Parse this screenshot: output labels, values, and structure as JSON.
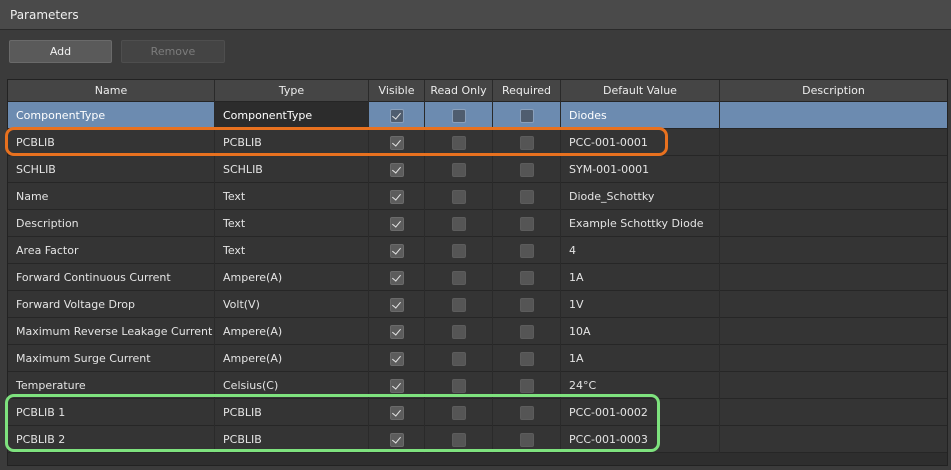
{
  "panel": {
    "title": "Parameters"
  },
  "toolbar": {
    "add_label": "Add",
    "remove_label": "Remove"
  },
  "columns": [
    "Name",
    "Type",
    "Visible",
    "Read Only",
    "Required",
    "Default Value",
    "Description"
  ],
  "rows": [
    {
      "name": "ComponentType",
      "type": "ComponentType",
      "visible": true,
      "read_only": false,
      "required": false,
      "default": "Diodes",
      "description": "",
      "selected": true
    },
    {
      "name": "PCBLIB",
      "type": "PCBLIB",
      "visible": true,
      "read_only": false,
      "required": false,
      "default": "PCC-001-0001",
      "description": ""
    },
    {
      "name": "SCHLIB",
      "type": "SCHLIB",
      "visible": true,
      "read_only": false,
      "required": false,
      "default": "SYM-001-0001",
      "description": ""
    },
    {
      "name": "Name",
      "type": "Text",
      "visible": true,
      "read_only": false,
      "required": false,
      "default": "Diode_Schottky",
      "description": ""
    },
    {
      "name": "Description",
      "type": "Text",
      "visible": true,
      "read_only": false,
      "required": false,
      "default": "Example Schottky Diode",
      "description": ""
    },
    {
      "name": "Area Factor",
      "type": "Text",
      "visible": true,
      "read_only": false,
      "required": false,
      "default": "4",
      "description": ""
    },
    {
      "name": "Forward Continuous Current",
      "type": "Ampere(A)",
      "visible": true,
      "read_only": false,
      "required": false,
      "default": "1A",
      "description": ""
    },
    {
      "name": "Forward Voltage Drop",
      "type": "Volt(V)",
      "visible": true,
      "read_only": false,
      "required": false,
      "default": "1V",
      "description": ""
    },
    {
      "name": "Maximum Reverse Leakage Current",
      "type": "Ampere(A)",
      "visible": true,
      "read_only": false,
      "required": false,
      "default": "10A",
      "description": ""
    },
    {
      "name": "Maximum Surge Current",
      "type": "Ampere(A)",
      "visible": true,
      "read_only": false,
      "required": false,
      "default": "1A",
      "description": ""
    },
    {
      "name": "Temperature",
      "type": "Celsius(C)",
      "visible": true,
      "read_only": false,
      "required": false,
      "default": "24°C",
      "description": ""
    },
    {
      "name": "PCBLIB 1",
      "type": "PCBLIB",
      "visible": true,
      "read_only": false,
      "required": false,
      "default": "PCC-001-0002",
      "description": ""
    },
    {
      "name": "PCBLIB 2",
      "type": "PCBLIB",
      "visible": true,
      "read_only": false,
      "required": false,
      "default": "PCC-001-0003",
      "description": ""
    }
  ],
  "colors": {
    "selection": "#6c8bb0",
    "highlight_orange": "#e8711f",
    "highlight_green": "#7ee27e"
  }
}
